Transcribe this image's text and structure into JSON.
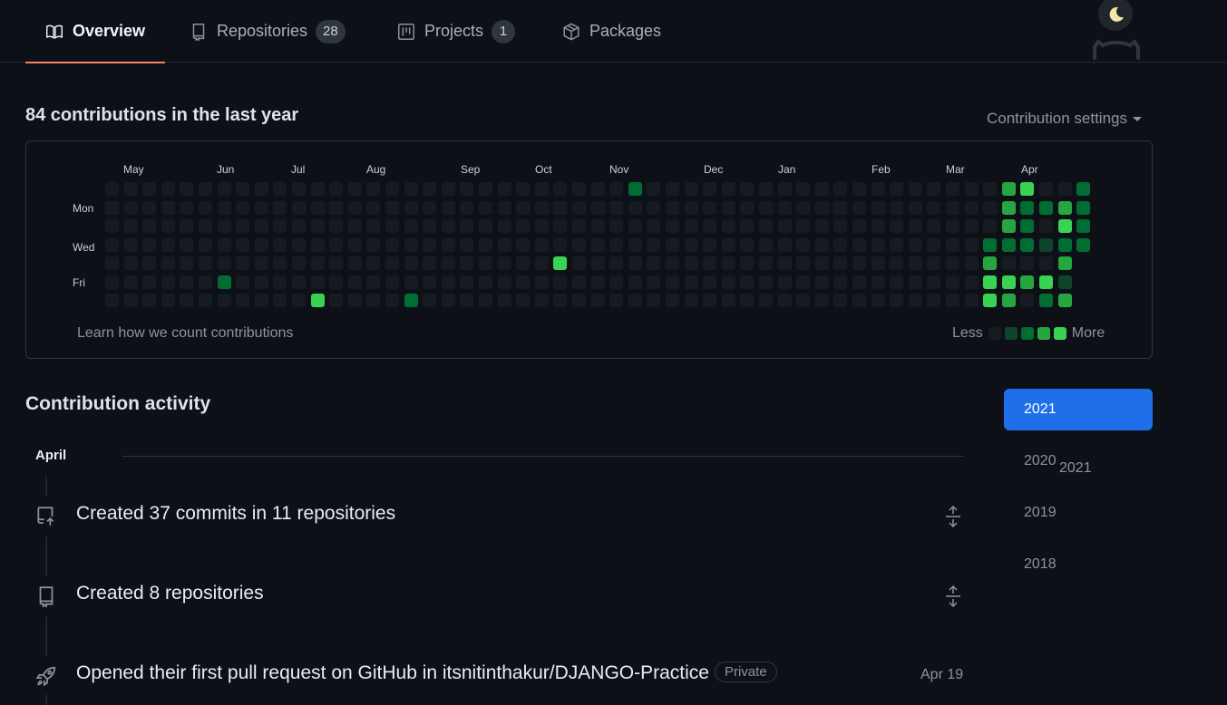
{
  "tabs": [
    {
      "label": "Overview",
      "icon": "book-icon",
      "selected": true
    },
    {
      "label": "Repositories",
      "icon": "repo-icon",
      "count": "28"
    },
    {
      "label": "Projects",
      "icon": "project-icon",
      "count": "1"
    },
    {
      "label": "Packages",
      "icon": "package-icon"
    }
  ],
  "contributions": {
    "title": "84 contributions in the last year",
    "settings_label": "Contribution settings",
    "months": [
      "May",
      "Jun",
      "Jul",
      "Aug",
      "Sep",
      "Oct",
      "Nov",
      "Dec",
      "Jan",
      "Feb",
      "Mar",
      "Apr"
    ],
    "days": [
      "Mon",
      "Wed",
      "Fri"
    ],
    "learn_link": "Learn how we count contributions",
    "legend_less": "Less",
    "legend_more": "More",
    "level_colors": [
      "#161b22",
      "#0e4429",
      "#006d32",
      "#26a641",
      "#39d353"
    ]
  },
  "activity": {
    "title": "Contribution activity",
    "month": "April",
    "year": "2021",
    "items": [
      {
        "icon": "repo-push-icon",
        "text": "Created 37 commits in 11 repositories",
        "expandable": true
      },
      {
        "icon": "repo-icon",
        "text": "Created 8 repositories",
        "expandable": true
      },
      {
        "icon": "rocket-icon",
        "text": "Opened their first pull request on GitHub in itsnitinthakur/DJANGO-Practice",
        "badge": "Private",
        "date": "Apr 19"
      }
    ]
  },
  "years": [
    "2021",
    "2020",
    "2019",
    "2018"
  ],
  "selected_year": "2021"
}
